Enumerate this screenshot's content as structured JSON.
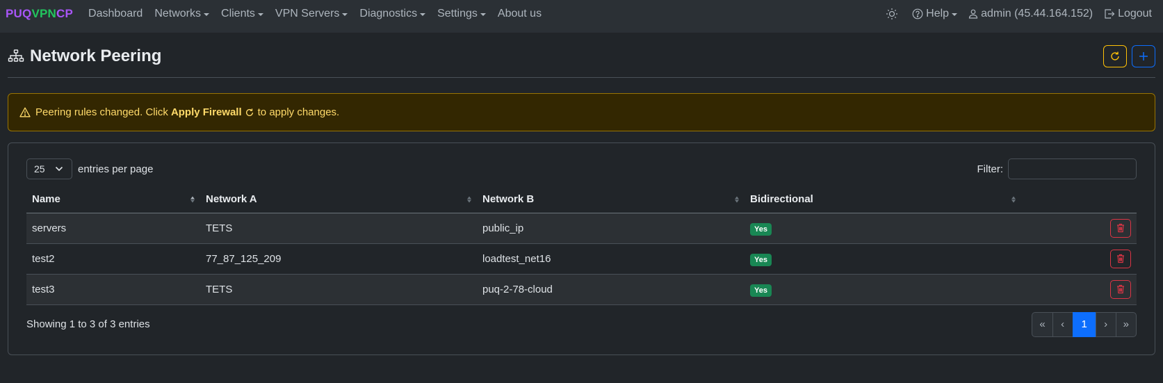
{
  "brand": {
    "part1": "PUQ",
    "part2": "VPN",
    "part3": "CP"
  },
  "nav": {
    "items": [
      {
        "label": "Dashboard",
        "dropdown": false
      },
      {
        "label": "Networks",
        "dropdown": true
      },
      {
        "label": "Clients",
        "dropdown": true
      },
      {
        "label": "VPN Servers",
        "dropdown": true
      },
      {
        "label": "Diagnostics",
        "dropdown": true
      },
      {
        "label": "Settings",
        "dropdown": true
      },
      {
        "label": "About us",
        "dropdown": false
      }
    ],
    "help_label": "Help",
    "user_label": "admin (45.44.164.152)",
    "logout_label": "Logout"
  },
  "page": {
    "title": "Network Peering"
  },
  "alert": {
    "text_before": "Peering rules changed. Click",
    "action": "Apply Firewall",
    "text_after": "to apply changes."
  },
  "table_controls": {
    "page_length": "25",
    "entries_label": "entries per page",
    "filter_label": "Filter:",
    "filter_value": ""
  },
  "table": {
    "headers": [
      "Name",
      "Network A",
      "Network B",
      "Bidirectional"
    ],
    "rows": [
      {
        "name": "servers",
        "network_a": "TETS",
        "network_b": "public_ip",
        "bidirectional": "Yes"
      },
      {
        "name": "test2",
        "network_a": "77_87_125_209",
        "network_b": "loadtest_net16",
        "bidirectional": "Yes"
      },
      {
        "name": "test3",
        "network_a": "TETS",
        "network_b": "puq-2-78-cloud",
        "bidirectional": "Yes"
      }
    ]
  },
  "footer": {
    "info": "Showing 1 to 3 of 3 entries",
    "pager": {
      "first": "«",
      "prev": "‹",
      "current": "1",
      "next": "›",
      "last": "»"
    }
  },
  "colors": {
    "accent_purple": "#a855f7",
    "accent_green": "#22c55e",
    "warning": "#ffc107",
    "primary": "#0d6efd",
    "danger": "#dc3545",
    "success_badge": "#198754"
  }
}
